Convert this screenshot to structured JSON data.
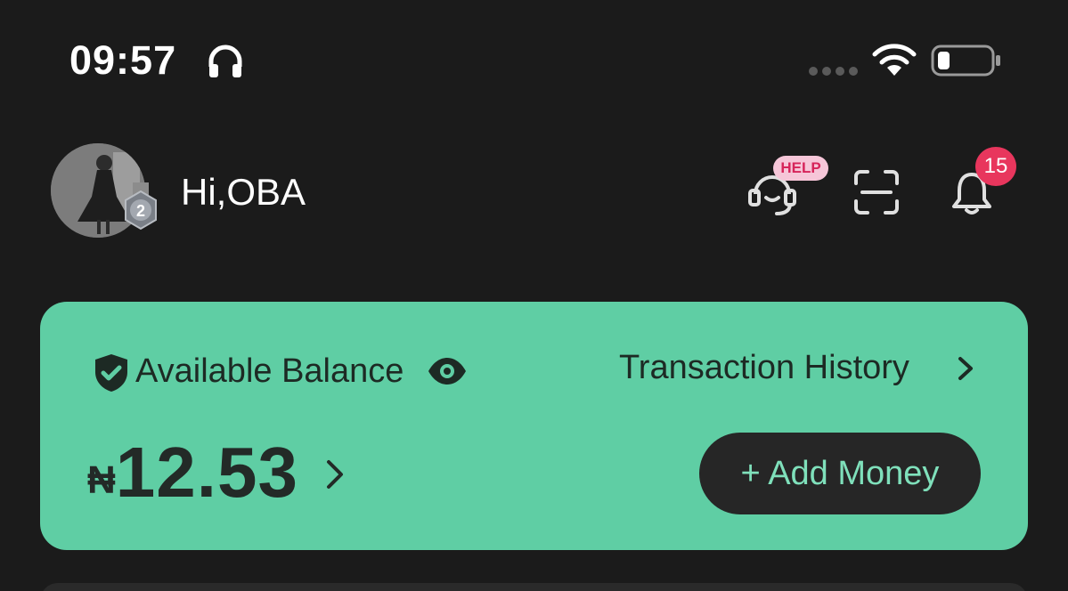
{
  "status_bar": {
    "time": "09:57",
    "icons": [
      "headphones-icon",
      "signal-icon",
      "wifi-icon",
      "battery-icon"
    ]
  },
  "header": {
    "greeting": "Hi,OBA",
    "rank_badge": "2",
    "help_label": "HELP",
    "notification_count": "15"
  },
  "balance_card": {
    "label": "Available Balance",
    "history_label": "Transaction History",
    "currency": "₦",
    "amount": "12.53",
    "add_money_label": "+ Add Money"
  },
  "colors": {
    "background": "#1b1b1b",
    "card_green": "#5fcea4",
    "badge_red": "#e8365d",
    "help_pink": "#f6c6d8",
    "button_dark": "#262626"
  }
}
